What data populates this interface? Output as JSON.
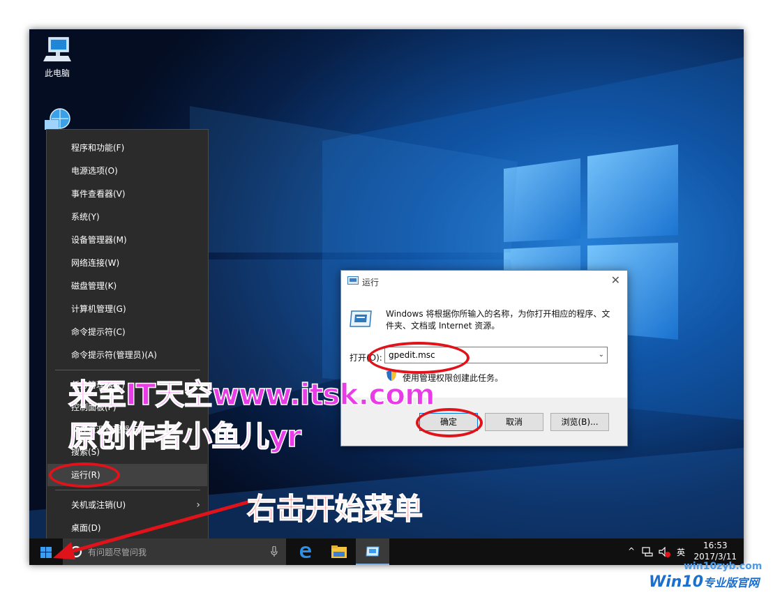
{
  "desktop": {
    "icons": [
      {
        "label": "此电脑",
        "icon": "computer-icon"
      },
      {
        "label": "",
        "icon": "network-icon"
      }
    ]
  },
  "context_menu": {
    "items": [
      {
        "label": "程序和功能(F)"
      },
      {
        "label": "电源选项(O)"
      },
      {
        "label": "事件查看器(V)"
      },
      {
        "label": "系统(Y)"
      },
      {
        "label": "设备管理器(M)"
      },
      {
        "label": "网络连接(W)"
      },
      {
        "label": "磁盘管理(K)"
      },
      {
        "label": "计算机管理(G)"
      },
      {
        "label": "命令提示符(C)"
      },
      {
        "label": "命令提示符(管理员)(A)"
      },
      {
        "label": "任务管理器(T)"
      },
      {
        "label": "控制面板(P)"
      },
      {
        "label": "文件资源管理器(E)"
      },
      {
        "label": "搜索(S)"
      },
      {
        "label": "运行(R)"
      },
      {
        "label": "关机或注销(U)"
      },
      {
        "label": "桌面(D)"
      }
    ],
    "highlighted": "运行(R)"
  },
  "run_dialog": {
    "title": "运行",
    "description": "Windows 将根据你所输入的名称，为你打开相应的程序、文件夹、文档或 Internet 资源。",
    "open_label": "打开(O):",
    "input_value": "gpedit.msc",
    "admin_note": "使用管理权限创建此任务。",
    "ok_label": "确定",
    "cancel_label": "取消",
    "browse_label": "浏览(B)..."
  },
  "taskbar": {
    "search_placeholder": "有问题尽管问我",
    "ime": "英",
    "time": "16:53",
    "date": "2017/3/11"
  },
  "overlays": {
    "watermark_line1": "来至IT天空www.itsk.com",
    "watermark_line2": "原创作者小鱼儿yr",
    "hint": "右击开始菜单",
    "site": "win10zyb.com",
    "brand_main": "Win10",
    "brand_sub": "专业版官网"
  },
  "colors": {
    "accent": "#0078d7",
    "annotation_red": "#e0131b",
    "watermark_magenta": "#e83ce6"
  }
}
